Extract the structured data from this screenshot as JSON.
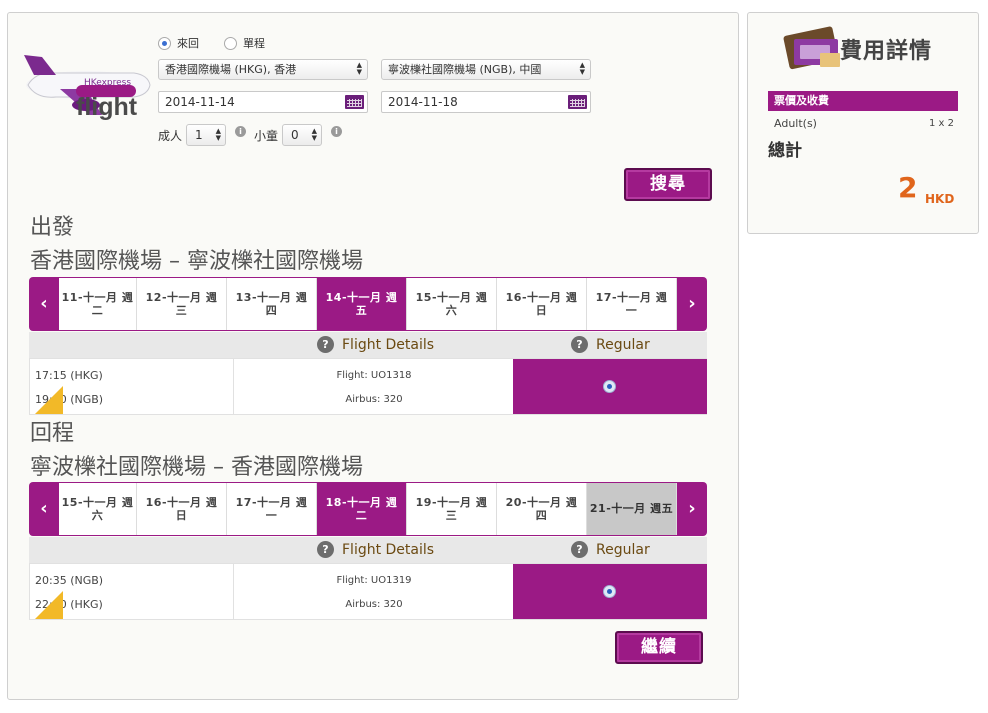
{
  "search": {
    "trip_roundtrip": "來回",
    "trip_oneway": "單程",
    "origin": "香港國際機場 (HKG), 香港",
    "destination": "寧波櫟社國際機場 (NGB), 中國",
    "depart_date": "2014-11-14",
    "return_date": "2014-11-18",
    "adults_label": "成人",
    "adults_value": "1",
    "children_label": "小童",
    "children_value": "0",
    "search_button": "搜尋"
  },
  "logo_text": "flight",
  "outbound": {
    "heading": "出發",
    "route": "香港國際機場 – 寧波櫟社國際機場",
    "days": [
      {
        "line1": "11-十一月 週",
        "line2": "二"
      },
      {
        "line1": "12-十一月 週",
        "line2": "三"
      },
      {
        "line1": "13-十一月 週",
        "line2": "四"
      },
      {
        "line1": "14-十一月 週",
        "line2": "五"
      },
      {
        "line1": "15-十一月 週",
        "line2": "六"
      },
      {
        "line1": "16-十一月 週",
        "line2": "日"
      },
      {
        "line1": "17-十一月 週",
        "line2": "一"
      }
    ],
    "header_details": "Flight Details",
    "header_fare": "Regular",
    "depart_time": "17:15 (HKG)",
    "arrive_time": "19:20 (NGB)",
    "flight_no": "Flight: UO1318",
    "aircraft": "Airbus: 320"
  },
  "inbound": {
    "heading": "回程",
    "route": "寧波櫟社國際機場 – 香港國際機場",
    "days": [
      {
        "line1": "15-十一月 週",
        "line2": "六"
      },
      {
        "line1": "16-十一月 週",
        "line2": "日"
      },
      {
        "line1": "17-十一月 週",
        "line2": "一"
      },
      {
        "line1": "18-十一月 週",
        "line2": "二"
      },
      {
        "line1": "19-十一月 週",
        "line2": "三"
      },
      {
        "line1": "20-十一月 週",
        "line2": "四"
      },
      {
        "line1": "21-十一月 週五",
        "line2": ""
      }
    ],
    "header_details": "Flight Details",
    "header_fare": "Regular",
    "depart_time": "20:35 (NGB)",
    "arrive_time": "22:50 (HKG)",
    "flight_no": "Flight: UO1319",
    "aircraft": "Airbus: 320"
  },
  "continue_button": "繼續",
  "cost": {
    "title": "費用詳情",
    "section": "票價及收費",
    "adult_label": "Adult(s)",
    "adult_qty": "1 x 2",
    "total_label": "總計",
    "total_amount": "2",
    "currency": "HKD"
  },
  "colors": {
    "brand": "#9b1a85",
    "accent": "#e0651c",
    "plane_corner": "#f2b928"
  }
}
